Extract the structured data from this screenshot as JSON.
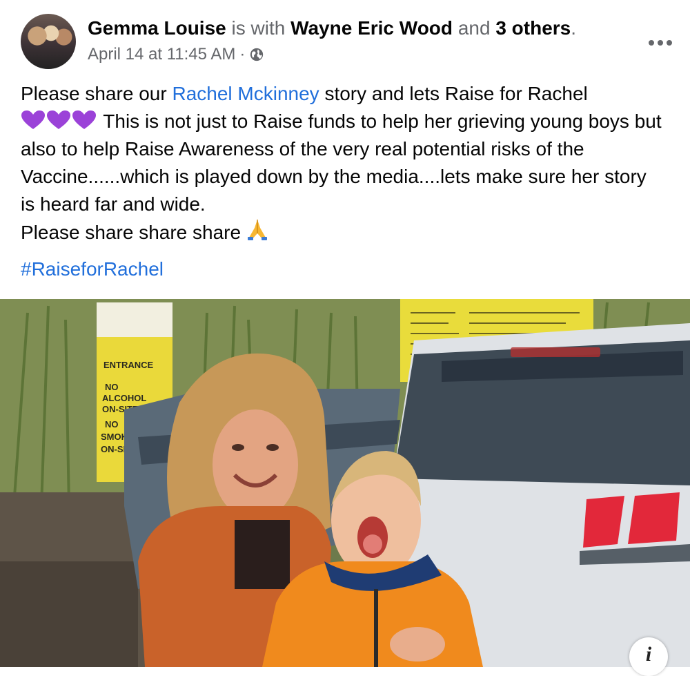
{
  "post": {
    "author": "Gemma Louise",
    "is_with": "is with",
    "tagged_name": "Wayne Eric Wood",
    "and_text": "and",
    "others": "3 others",
    "period": ".",
    "timestamp": "April 14 at 11:45 AM",
    "separator": "·",
    "privacy_icon": "globe-icon",
    "more_icon": "more-options-icon"
  },
  "content": {
    "line1_before": "Please share our ",
    "link": "Rachel Mckinney",
    "line1_after": " story and lets Raise for Rachel",
    "hearts_icon": "purple-heart-icon",
    "line2": " This is not just to Raise funds to help her grieving young boys but also to help Raise Awareness of the very real potential risks of the Vaccine......which is played down by the media....lets make sure her story is heard far and wide.",
    "line3": "Please share share share ",
    "pray_icon": "folded-hands-icon",
    "hashtag": "#RaiseforRachel"
  },
  "photo": {
    "sign_left_lines": [
      "ENTRANCE",
      "NO",
      "ALCOHOL",
      "ON-SITE",
      "NO",
      "SMOKING",
      "ON-SITE"
    ],
    "info_label": "i"
  },
  "colors": {
    "link": "#216fdb",
    "muted": "#65676b",
    "heart": "#9b42d8"
  }
}
